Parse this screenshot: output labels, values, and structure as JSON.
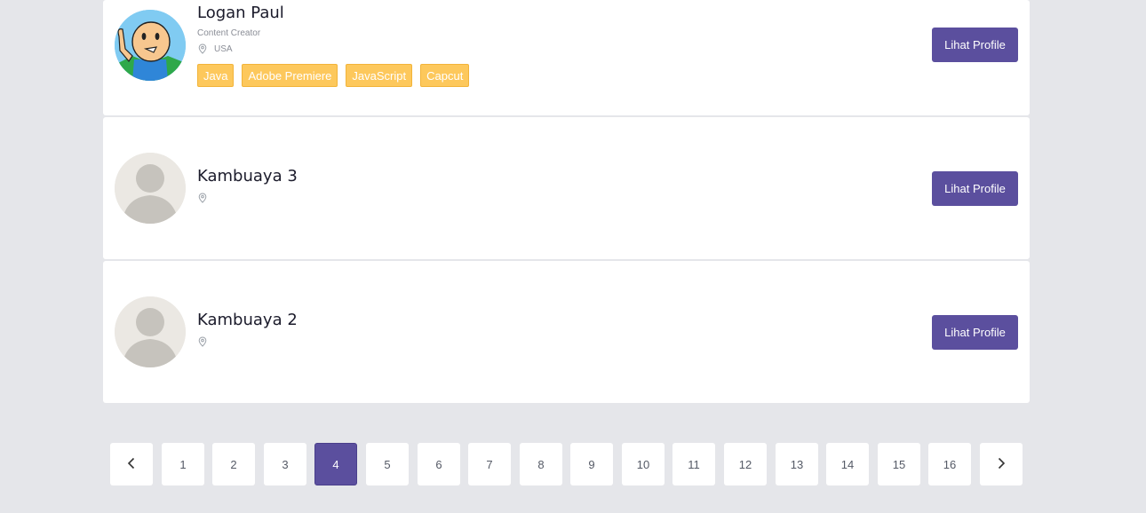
{
  "profiles": [
    {
      "name": "Logan Paul",
      "role": "Content Creator",
      "location": "USA",
      "skills": [
        "Java",
        "Adobe Premiere",
        "JavaScript",
        "Capcut"
      ],
      "button_label": "Lihat Profile",
      "avatar": "cartoon-avatar"
    },
    {
      "name": "Kambuaya 3",
      "location": "",
      "button_label": "Lihat Profile",
      "avatar": "default-avatar"
    },
    {
      "name": "Kambuaya 2",
      "location": "",
      "button_label": "Lihat Profile",
      "avatar": "default-avatar"
    }
  ],
  "pagination": {
    "pages": [
      "1",
      "2",
      "3",
      "4",
      "5",
      "6",
      "7",
      "8",
      "9",
      "10",
      "11",
      "12",
      "13",
      "14",
      "15",
      "16"
    ],
    "current": "4",
    "prev_icon": "chevron-left-icon",
    "next_icon": "chevron-right-icon"
  },
  "colors": {
    "background": "#e5e6ea",
    "primary": "#5b4f9e",
    "tag": "#fdc85c"
  }
}
